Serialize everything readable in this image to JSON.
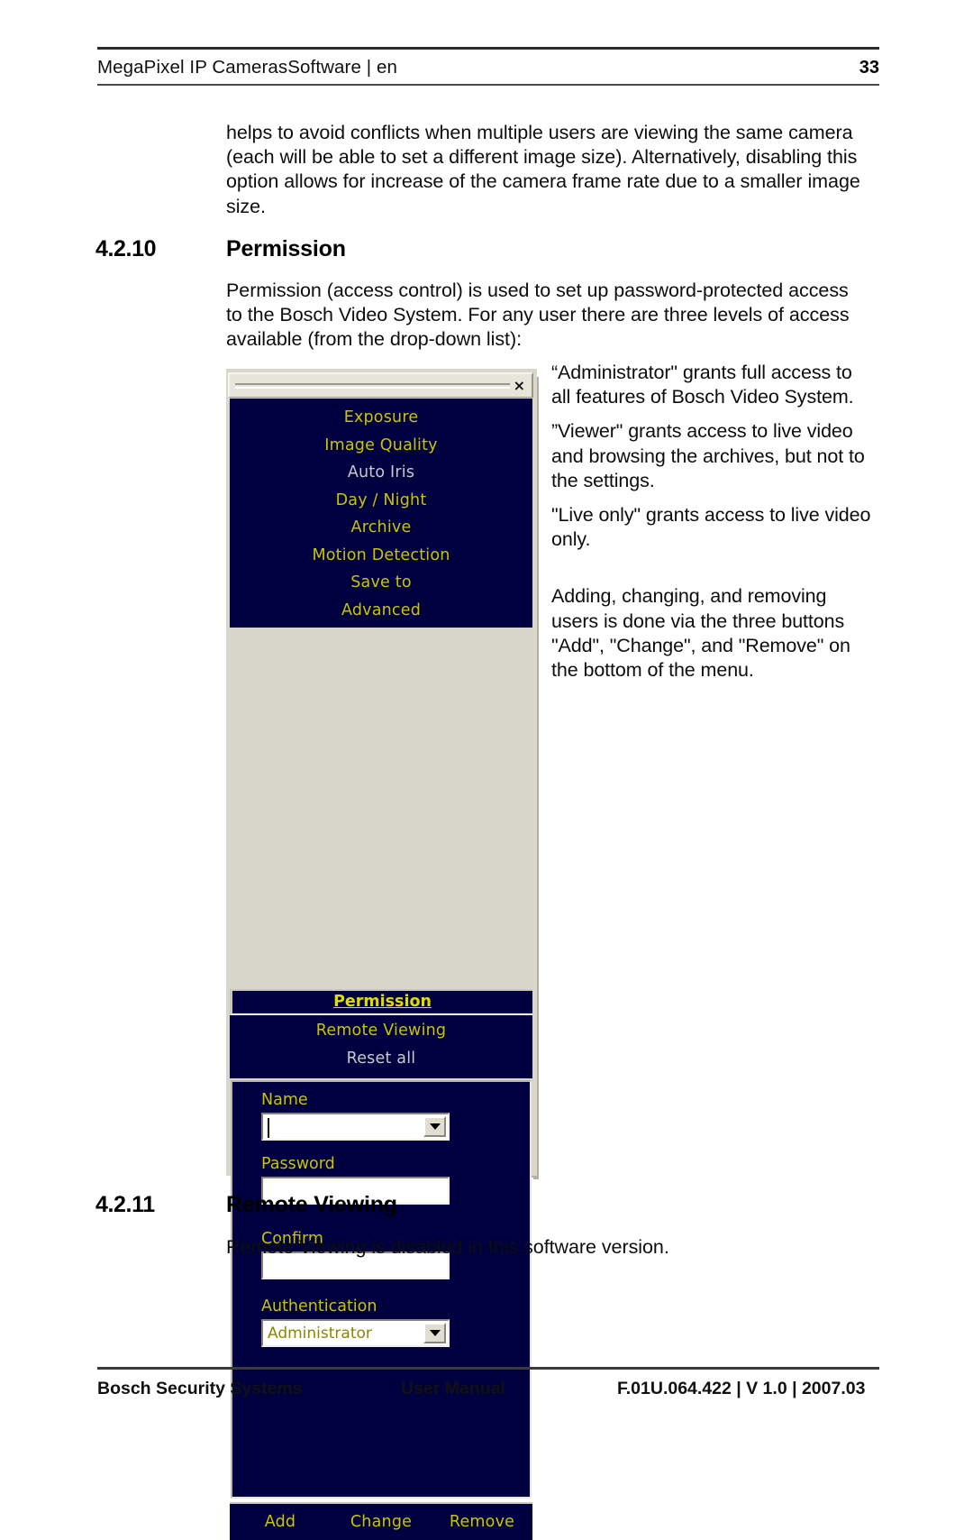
{
  "header": {
    "title": "MegaPixel IP CamerasSoftware | en",
    "page_number": "33"
  },
  "body": {
    "continued_paragraph": "helps to avoid conflicts when multiple users are viewing the same camera (each will be able to set a different image size). Alternatively, disabling this option allows for increase of the camera frame rate due to a smaller image size."
  },
  "sections": [
    {
      "number": "4.2.10",
      "title": "Permission",
      "intro": "Permission (access control) is used to set up password-protected access to the Bosch Video System. For any user there are three levels of access available (from the drop-down list):"
    },
    {
      "number": "4.2.11",
      "title": "Remote Viewing",
      "intro": "Remote Viewing is disabled in this software version."
    }
  ],
  "notes": [
    "“Administrator\" grants full access to all features of Bosch Video System.",
    "”Viewer\" grants access to live video and browsing the archives, but not to the settings.",
    "\"Live only\" grants access to live video only.",
    "Adding, changing, and removing users is done via the three buttons \"Add\", \"Change\", and \"Remove\" on the bottom of the menu."
  ],
  "app": {
    "close_label": "×",
    "menu_items_top": [
      {
        "label": "Exposure",
        "dim": false
      },
      {
        "label": "Image Quality",
        "dim": false
      },
      {
        "label": "Auto Iris",
        "dim": true
      },
      {
        "label": "Day / Night",
        "dim": false
      },
      {
        "label": "Archive",
        "dim": false
      },
      {
        "label": "Motion Detection",
        "dim": false
      },
      {
        "label": "Save to",
        "dim": false
      },
      {
        "label": "Advanced",
        "dim": false
      }
    ],
    "menu_selected": "Permission",
    "menu_items_bottom": [
      {
        "label": "Remote Viewing",
        "dim": false
      },
      {
        "label": "Reset all",
        "dim": true
      }
    ],
    "form": {
      "name_label": "Name",
      "name_value": "",
      "password_label": "Password",
      "password_value": "",
      "confirm_label": "Confirm",
      "confirm_value": "",
      "authentication_label": "Authentication",
      "authentication_value": "Administrator"
    },
    "buttons": [
      {
        "label": "Add"
      },
      {
        "label": "Change"
      },
      {
        "label": "Remove"
      }
    ],
    "colors": {
      "window_bg": "#000040",
      "menu_text": "#c8c400",
      "menu_text_dim": "#c9c9c9",
      "chrome": "#e8e6da"
    }
  },
  "footer": {
    "left": "Bosch Security Systems",
    "middle": "User Manual",
    "right": "F.01U.064.422 | V 1.0 | 2007.03"
  }
}
